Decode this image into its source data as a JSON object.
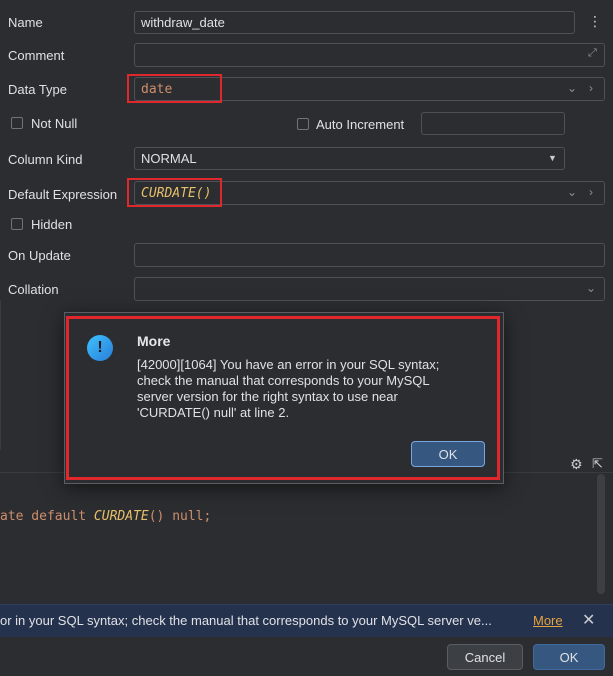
{
  "form": {
    "name_label": "Name",
    "name_value": "withdraw_date",
    "comment_label": "Comment",
    "comment_value": "",
    "data_type_label": "Data Type",
    "data_type_value": "date",
    "not_null_label": "Not Null",
    "auto_increment_label": "Auto Increment",
    "column_kind_label": "Column Kind",
    "column_kind_value": "NORMAL",
    "default_expression_label": "Default Expression",
    "default_expression_value": "CURDATE()",
    "hidden_label": "Hidden",
    "on_update_label": "On Update",
    "collation_label": "Collation"
  },
  "dialog": {
    "title": "More",
    "message": "[42000][1064] You have an error in your SQL syntax;\ncheck the manual that corresponds to your MySQL\nserver version for the right syntax to use near\n'CURDATE() null' at line 2.",
    "ok_label": "OK"
  },
  "preview": {
    "code_prefix": "ate default ",
    "code_func": "CURDATE",
    "code_suffix": "() null;"
  },
  "error_bar": {
    "text": "or in your SQL syntax; check the manual that corresponds to your MySQL server ve...",
    "more_label": "More"
  },
  "footer": {
    "cancel_label": "Cancel",
    "ok_label": "OK"
  },
  "colors": {
    "accent_red": "#e0272b",
    "keyword_orange": "#cf8e6d",
    "function_yellow": "#e8bf6a",
    "primary_button": "#365880",
    "link_orange": "#e6a23c"
  }
}
